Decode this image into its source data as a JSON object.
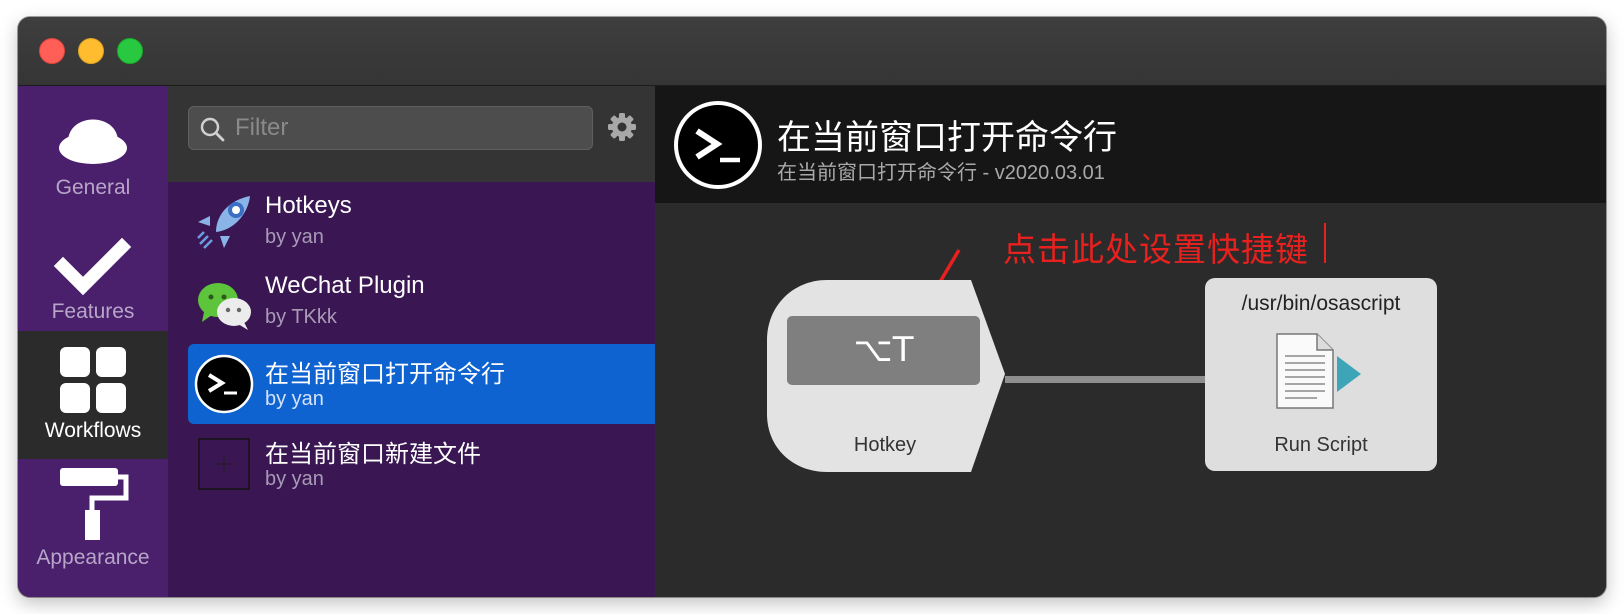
{
  "sidebar": {
    "categories": [
      {
        "label": "General",
        "icon": "hat-icon"
      },
      {
        "label": "Features",
        "icon": "checkmark-icon"
      },
      {
        "label": "Workflows",
        "icon": "grid-icon"
      },
      {
        "label": "Appearance",
        "icon": "paint-roller-icon"
      }
    ],
    "active": "Workflows"
  },
  "filter": {
    "placeholder": "Filter"
  },
  "workflows": [
    {
      "title": "Hotkeys",
      "author": "by yan",
      "icon": "rocket-icon"
    },
    {
      "title": "WeChat Plugin",
      "author": "by TKkk",
      "icon": "wechat-icon"
    },
    {
      "title": "在当前窗口打开命令行",
      "author": "by yan",
      "icon": "terminal-icon",
      "selected": true
    },
    {
      "title": "在当前窗口新建文件",
      "author": "by yan",
      "icon": "placeholder-icon"
    }
  ],
  "editor": {
    "title": "在当前窗口打开命令行",
    "subtitle": "在当前窗口打开命令行 - v2020.03.01",
    "annotation": "点击此处设置快捷键",
    "hotkey_node": {
      "shortcut": "⌥T",
      "label": "Hotkey"
    },
    "script_node": {
      "path": "/usr/bin/osascript",
      "label": "Run Script"
    }
  },
  "colors": {
    "sidebar": "#4a1f6c",
    "list": "#3a1752",
    "selection": "#0f63d0",
    "annotation": "#e8211f"
  }
}
